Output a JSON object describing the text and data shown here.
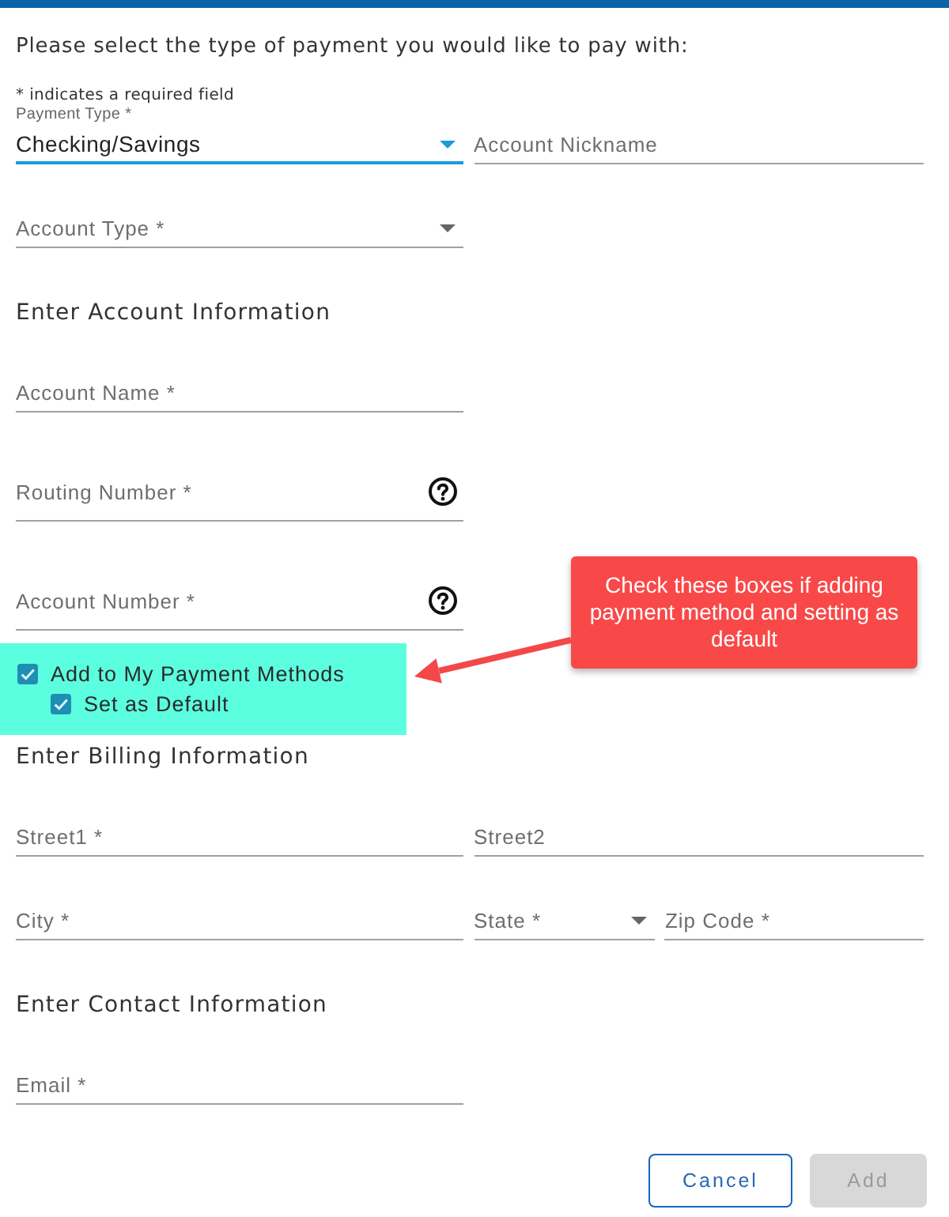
{
  "intro": {
    "prompt": "Please select the type of payment you would like to pay with:",
    "required_note": "* indicates a required field"
  },
  "sections": [
    {
      "rows": [
        [
          {
            "kind": "select",
            "label": "Payment Type *",
            "value": "Checking/Savings",
            "focused": true
          },
          {
            "kind": "text",
            "label": "Account Nickname",
            "focused": false
          }
        ],
        [
          {
            "kind": "select",
            "label": "Account Type *",
            "focused": false
          }
        ]
      ]
    },
    {
      "heading": "Enter Account Information",
      "rows": [
        [
          {
            "kind": "text",
            "label": "Account Name *",
            "focused": false
          }
        ],
        [
          {
            "kind": "text",
            "label": "Routing Number *",
            "help": true,
            "focused": false
          }
        ],
        [
          {
            "kind": "text",
            "label": "Account Number *",
            "help": true,
            "focused": false
          }
        ]
      ],
      "options": [
        {
          "label": "Add to My Payment Methods",
          "checked": true,
          "children": [
            {
              "label": "Set as Default",
              "checked": true
            }
          ]
        }
      ]
    },
    {
      "heading": "Enter Billing Information",
      "rows": [
        [
          {
            "kind": "text",
            "label": "Street1 *",
            "focused": false
          },
          {
            "kind": "text",
            "label": "Street2",
            "focused": false
          }
        ],
        [
          {
            "kind": "text",
            "label": "City *",
            "focused": false
          },
          {
            "kind": "select",
            "label": "State *",
            "focused": false
          },
          {
            "kind": "text",
            "label": "Zip Code *",
            "focused": false
          }
        ]
      ]
    },
    {
      "heading": "Enter Contact Information",
      "rows": [
        [
          {
            "kind": "text",
            "label": "Email *",
            "focused": false
          }
        ]
      ]
    }
  ],
  "buttons": [
    {
      "label": "Cancel",
      "kind": "outlined",
      "disabled": false
    },
    {
      "label": "Add",
      "kind": "filled",
      "disabled": true
    }
  ],
  "callout": {
    "text": "Check these boxes if adding payment method and setting as default"
  }
}
